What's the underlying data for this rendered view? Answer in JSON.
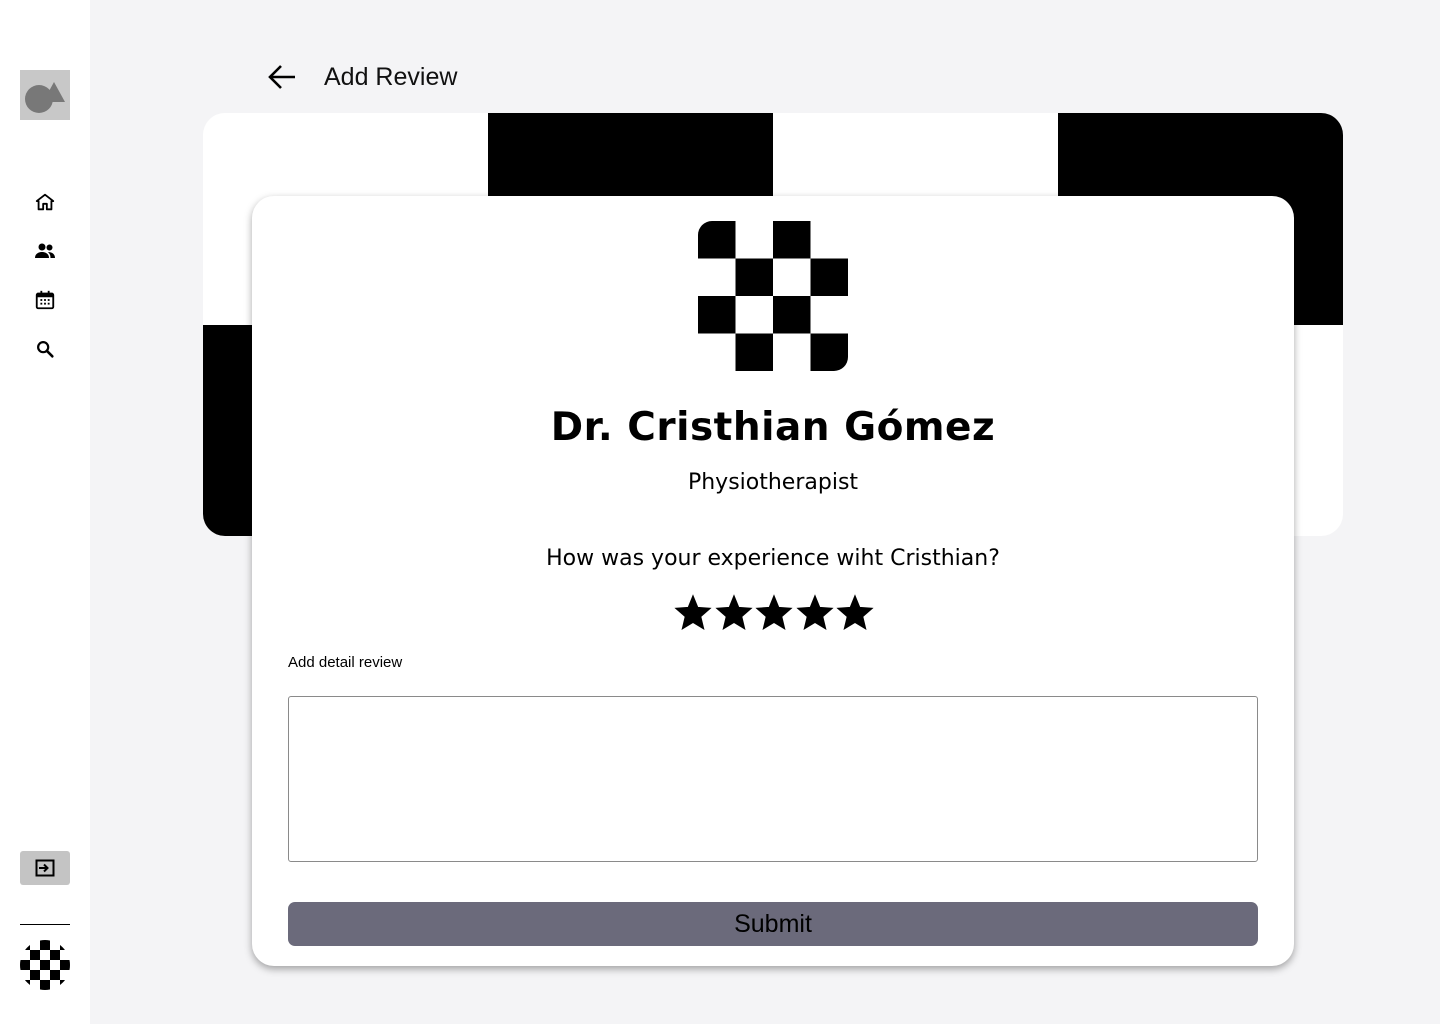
{
  "page": {
    "title": "Add Review"
  },
  "sidebar": {
    "logo_icon": "shapes-logo-icon",
    "items": [
      {
        "icon": "home-icon"
      },
      {
        "icon": "people-icon"
      },
      {
        "icon": "calendar-icon"
      },
      {
        "icon": "search-icon"
      }
    ],
    "logout_icon": "logout-icon",
    "avatar_icon": "user-avatar"
  },
  "doctor": {
    "name": "Dr. Cristhian Gómez",
    "role": "Physiotherapist"
  },
  "review": {
    "question": "How was your experience wiht Cristhian?",
    "rating": 5,
    "rating_max": 5,
    "detail_label": "Add detail review",
    "detail_value": "",
    "submit_label": "Submit"
  },
  "colors": {
    "background": "#f4f4f6",
    "submit_button": "#6b6a7b",
    "logout_button": "#c4c4c4"
  }
}
